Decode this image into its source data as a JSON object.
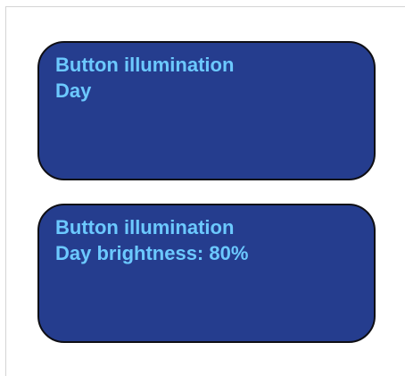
{
  "panels": [
    {
      "title": "Button illumination",
      "value": "Day"
    },
    {
      "title": "Button illumination",
      "value": "Day brightness: 80%"
    }
  ],
  "colors": {
    "panel_background": "#253d8e",
    "panel_text": "#6cc9ff",
    "panel_border": "#0f0f14",
    "page_background": "#ffffff"
  }
}
